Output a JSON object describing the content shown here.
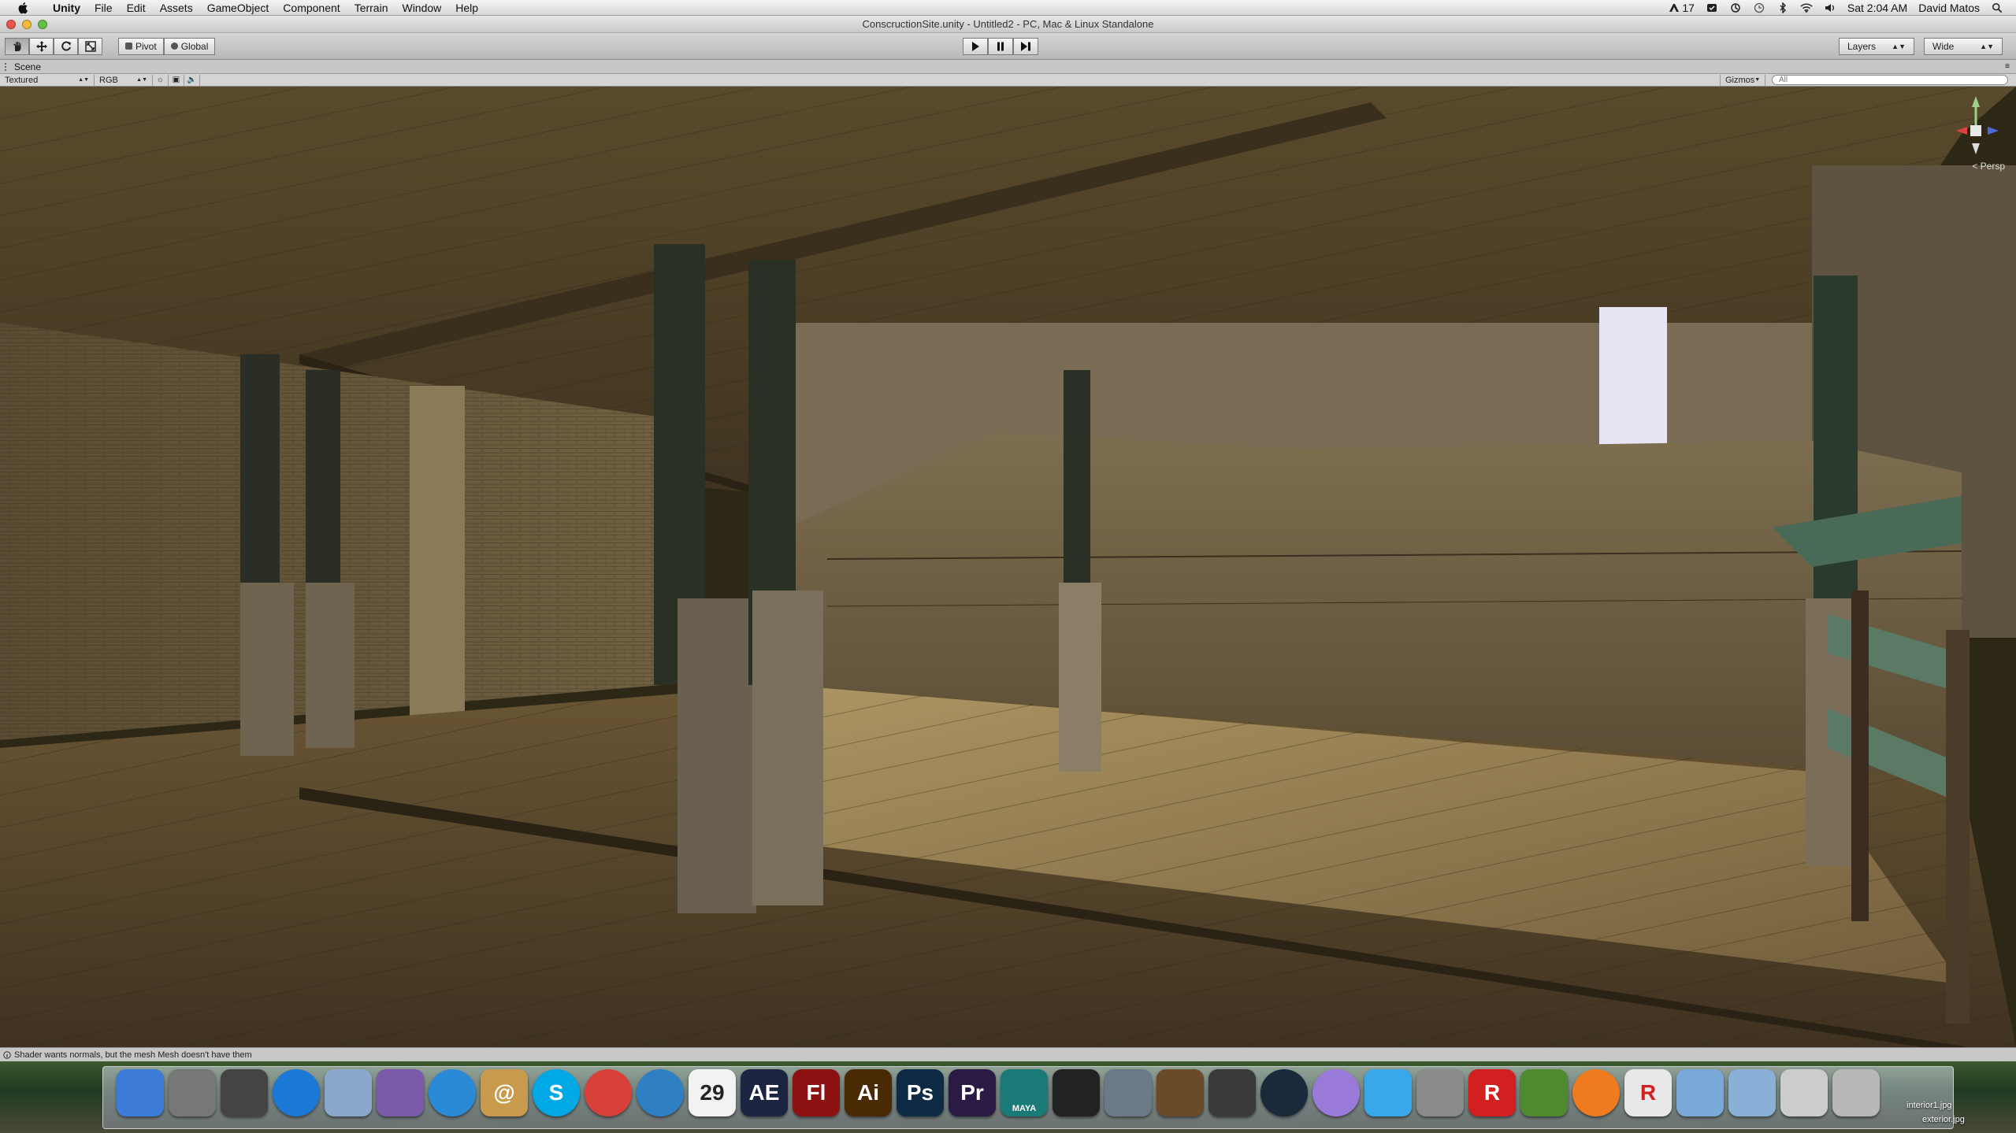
{
  "menubar": {
    "app_name": "Unity",
    "menus": [
      "File",
      "Edit",
      "Assets",
      "GameObject",
      "Component",
      "Terrain",
      "Window",
      "Help"
    ],
    "status": {
      "adobe_badge": "17",
      "clock": "Sat 2:04 AM",
      "user": "David Matos"
    }
  },
  "window": {
    "title": "ConscructionSite.unity - Untitled2 - PC, Mac & Linux Standalone"
  },
  "toolbar": {
    "pivot_label": "Pivot",
    "global_label": "Global",
    "layers_label": "Layers",
    "layout_label": "Wide"
  },
  "scene": {
    "tab_label": "Scene",
    "render_mode": "Textured",
    "color_mode": "RGB",
    "gizmos_label": "Gizmos",
    "search_placeholder": "All",
    "persp_label": "< Persp"
  },
  "status_bar": {
    "message": "Shader wants normals, but the mesh Mesh doesn't have them"
  },
  "dock": {
    "items": [
      {
        "name": "finder-icon",
        "label": "",
        "color": "#3d7bd8"
      },
      {
        "name": "launchpad-icon",
        "label": "",
        "color": "#777777"
      },
      {
        "name": "dashboard-icon",
        "label": "",
        "color": "#444444"
      },
      {
        "name": "app-store-icon",
        "label": "",
        "color": "#1b78d7"
      },
      {
        "name": "preview-icon",
        "label": "",
        "color": "#8aa7c9"
      },
      {
        "name": "script-editor-icon",
        "label": "",
        "color": "#7a5aa8"
      },
      {
        "name": "safari-icon",
        "label": "",
        "color": "#2a8ad8"
      },
      {
        "name": "contacts-icon",
        "label": "@",
        "color": "#c89b4c"
      },
      {
        "name": "skype-icon",
        "label": "S",
        "color": "#00a8e6"
      },
      {
        "name": "chrome-icon",
        "label": "",
        "color": "#d7413a"
      },
      {
        "name": "itunes-icon",
        "label": "",
        "color": "#2f7fc4"
      },
      {
        "name": "calendar-icon",
        "label": "29",
        "color": "#f2f2f2"
      },
      {
        "name": "after-effects-icon",
        "label": "AE",
        "color": "#1b2440"
      },
      {
        "name": "flash-icon",
        "label": "Fl",
        "color": "#8c1111"
      },
      {
        "name": "illustrator-icon",
        "label": "Ai",
        "color": "#4a2a05"
      },
      {
        "name": "photoshop-icon",
        "label": "Ps",
        "color": "#0e2a44"
      },
      {
        "name": "premiere-icon",
        "label": "Pr",
        "color": "#2a1a44"
      },
      {
        "name": "maya-icon",
        "label": "MAYA",
        "color": "#1a7a77"
      },
      {
        "name": "unity-icon",
        "label": "",
        "color": "#222222"
      },
      {
        "name": "wireless-icon",
        "label": "",
        "color": "#6c7a88"
      },
      {
        "name": "garageband-icon",
        "label": "",
        "color": "#6b4a2a"
      },
      {
        "name": "imovie-icon",
        "label": "",
        "color": "#3a3a3a"
      },
      {
        "name": "steam-icon",
        "label": "",
        "color": "#1a2a3a"
      },
      {
        "name": "sphere-icon",
        "label": "",
        "color": "#9a7ad8"
      },
      {
        "name": "cube-app-icon",
        "label": "",
        "color": "#3aa8e8"
      },
      {
        "name": "system-preferences-icon",
        "label": "",
        "color": "#8a8a8a"
      },
      {
        "name": "roblox-icon",
        "label": "R",
        "color": "#d21f1f"
      },
      {
        "name": "minecraft-icon",
        "label": "",
        "color": "#4e8a2e"
      },
      {
        "name": "origin-icon",
        "label": "",
        "color": "#f07b1e"
      },
      {
        "name": "roblox-studio-icon",
        "label": "R",
        "color": "#e8e8e8"
      },
      {
        "name": "applications-folder-icon",
        "label": "",
        "color": "#7aa8d8"
      },
      {
        "name": "documents-folder-icon",
        "label": "",
        "color": "#8ab0d8"
      },
      {
        "name": "unity-stack-icon",
        "label": "",
        "color": "#cccccc"
      },
      {
        "name": "trash-icon",
        "label": "",
        "color": "#b8b8b8"
      }
    ]
  },
  "desktop": {
    "file_1": "interior1.jpg",
    "file_2": "exterior.jpg"
  },
  "colors": {
    "accent_play": "#222222",
    "viewport_bg": "#2d2716"
  }
}
